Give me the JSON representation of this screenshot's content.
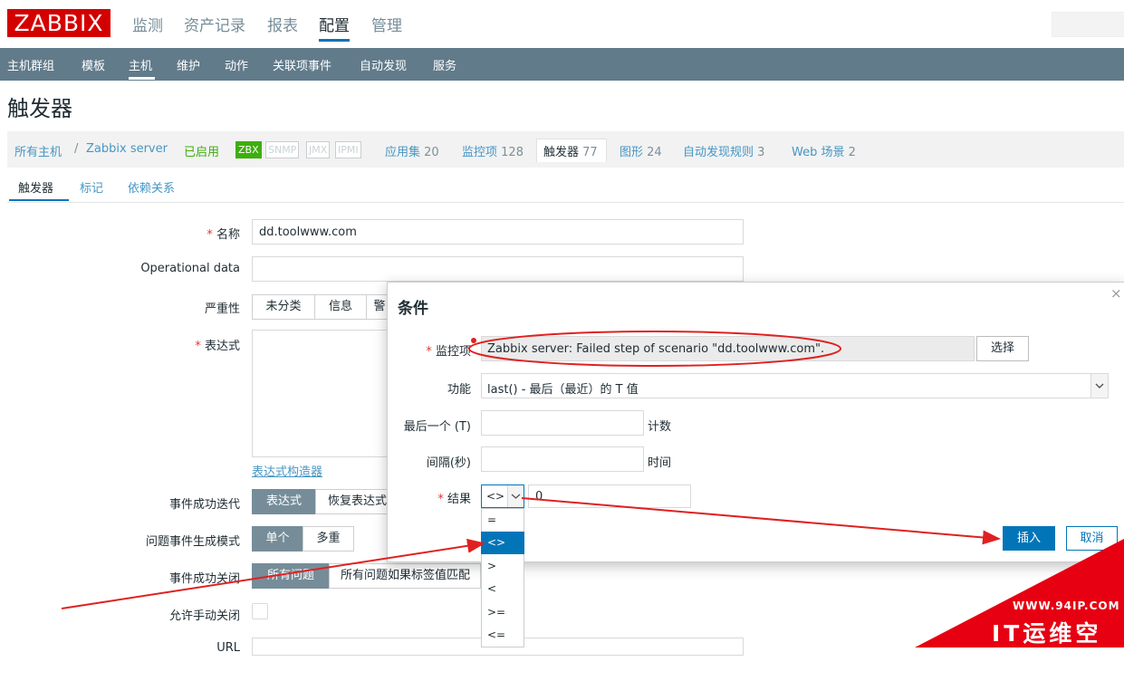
{
  "logo": "ZABBIX",
  "top_menu": [
    "监测",
    "资产记录",
    "报表",
    "配置",
    "管理"
  ],
  "sub_menu": [
    "主机群组",
    "模板",
    "主机",
    "维护",
    "动作",
    "关联项事件",
    "自动发现",
    "服务"
  ],
  "page_title": "触发器",
  "breadcrumb": {
    "all_hosts": "所有主机",
    "sep": "/",
    "host": "Zabbix server",
    "status": "已启用",
    "tags": [
      "ZBX",
      "SNMP",
      "JMX",
      "IPMI"
    ],
    "links": [
      {
        "label": "应用集",
        "count": "20"
      },
      {
        "label": "监控项",
        "count": "128"
      },
      {
        "label": "触发器",
        "count": "77"
      },
      {
        "label": "图形",
        "count": "24"
      },
      {
        "label": "自动发现规则",
        "count": "3"
      },
      {
        "label": "Web 场景",
        "count": "2"
      }
    ]
  },
  "tabs": [
    "触发器",
    "标记",
    "依赖关系"
  ],
  "form": {
    "name_label": "名称",
    "name_value": "dd.toolwww.com",
    "opdata_label": "Operational data",
    "severity_label": "严重性",
    "severity_options": [
      "未分类",
      "信息",
      "警"
    ],
    "expression_label": "表达式",
    "expression_builder": "表达式构造器",
    "ok_event_label": "事件成功迭代",
    "ok_event_options": [
      "表达式",
      "恢复表达式"
    ],
    "problem_mode_label": "问题事件生成模式",
    "problem_mode_options": [
      "单个",
      "多重"
    ],
    "ok_close_label": "事件成功关闭",
    "ok_close_options": [
      "所有问题",
      "所有问题如果标签值匹配"
    ],
    "manual_close_label": "允许手动关闭",
    "url_label": "URL"
  },
  "modal": {
    "title": "条件",
    "close": "×",
    "item_label": "监控项",
    "item_value": "Zabbix server: Failed step of scenario \"dd.toolwww.com\".",
    "select_button": "选择",
    "function_label": "功能",
    "function_value": "last() - 最后（最近）的 T 值",
    "last_t_label": "最后一个 (T)",
    "last_t_suffix": "计数",
    "interval_label": "间隔(秒)",
    "interval_suffix": "时间",
    "result_label": "结果",
    "result_operator": "<>",
    "result_value": "0",
    "operators": [
      "=",
      "<>",
      ">",
      "<",
      ">=",
      "<="
    ],
    "selected_operator_index": 1,
    "insert_button": "插入",
    "cancel_button": "取消"
  },
  "watermark": {
    "url": "WWW.94IP.COM",
    "name": "IT运维空间"
  },
  "colors": {
    "brand_red": "#d40000",
    "submenu_bg": "#617b8b",
    "accent_blue": "#0275b8",
    "enabled_green": "#3daf0d",
    "annotation_red": "#e02020"
  }
}
